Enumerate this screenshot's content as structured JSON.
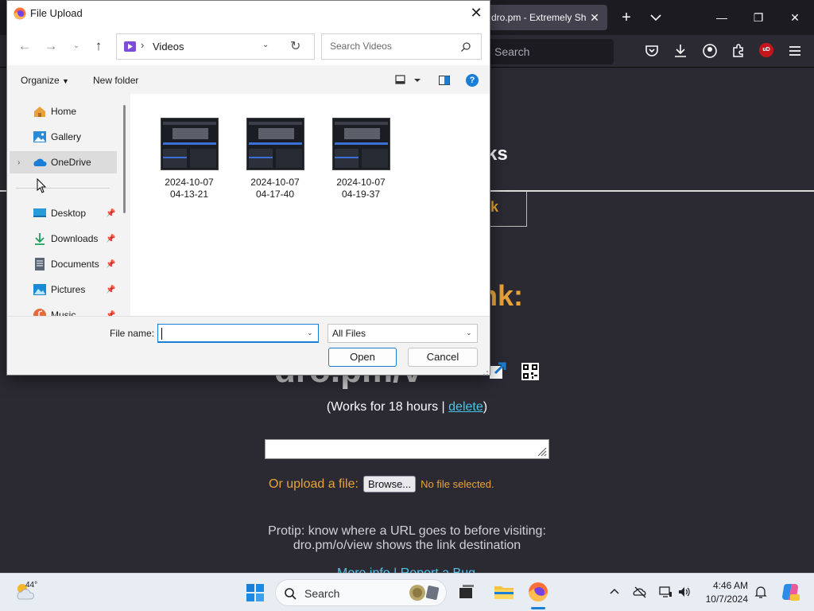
{
  "browser": {
    "tab_title": "dro.pm - Extremely Sh",
    "url_placeholder": "Search"
  },
  "page": {
    "heading_fragment": "ks",
    "link_fragment": "nk",
    "big_fragment": "nk:",
    "short_url": "dro.pm/v",
    "works_prefix": "(Works for 18 hours | ",
    "delete_label": "delete",
    "works_suffix": ")",
    "upload_label": "Or upload a file:",
    "browse_label": "Browse...",
    "no_file_label": "No file selected.",
    "protip_line1": "Protip: know where a URL goes to before visiting:",
    "protip_line2": "dro.pm/o/view shows the link destination",
    "footer_links": "More info | Report a Bug"
  },
  "dialog": {
    "title": "File Upload",
    "address_crumb": "Videos",
    "search_placeholder": "Search Videos",
    "toolbar": {
      "organize_label": "Organize",
      "new_folder_label": "New folder",
      "help_label": "?"
    },
    "nav_items": [
      {
        "label": "Home",
        "icon": "home-icon",
        "pinned": false
      },
      {
        "label": "Gallery",
        "icon": "gallery-icon",
        "pinned": false
      },
      {
        "label": "OneDrive",
        "icon": "onedrive-icon",
        "pinned": false,
        "selected": true,
        "expandable": true
      },
      {
        "label": "Desktop",
        "icon": "desktop-icon",
        "pinned": true
      },
      {
        "label": "Downloads",
        "icon": "downloads-icon",
        "pinned": true
      },
      {
        "label": "Documents",
        "icon": "documents-icon",
        "pinned": true
      },
      {
        "label": "Pictures",
        "icon": "pictures-icon",
        "pinned": true
      },
      {
        "label": "Music",
        "icon": "music-icon",
        "pinned": true
      }
    ],
    "files": [
      {
        "line1": "2024-10-07",
        "line2": "04-13-21"
      },
      {
        "line1": "2024-10-07",
        "line2": "04-17-40"
      },
      {
        "line1": "2024-10-07",
        "line2": "04-19-37"
      }
    ],
    "file_name_label": "File name:",
    "file_name_value": "",
    "file_type_value": "All Files",
    "open_label": "Open",
    "cancel_label": "Cancel"
  },
  "taskbar": {
    "weather_temp": "44°",
    "search_label": "Search",
    "time": "4:46 AM",
    "date": "10/7/2024"
  },
  "colors": {
    "accent": "#1a7ed6",
    "page_bg": "#2b2a33",
    "orange": "#e8a33a",
    "link": "#4cc4e8"
  }
}
